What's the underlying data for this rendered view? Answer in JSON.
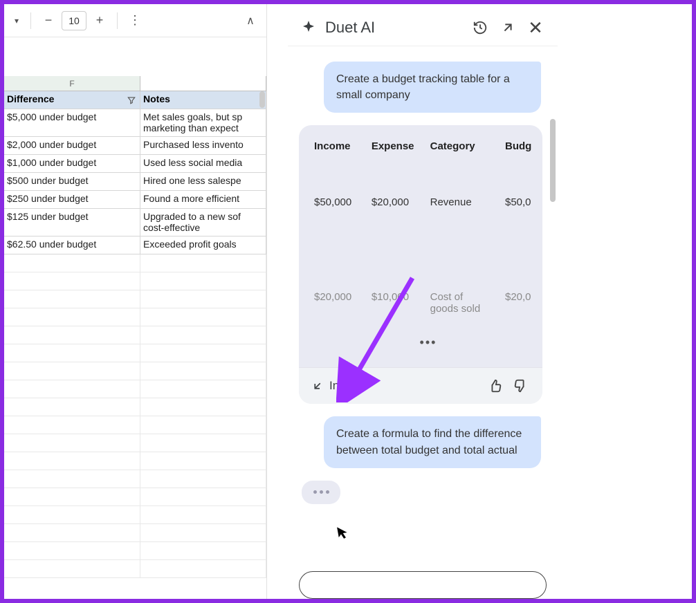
{
  "toolbar": {
    "font_size": "10"
  },
  "columns": {
    "F": "F",
    "difference_header": "Difference",
    "notes_header": "Notes"
  },
  "rows": [
    {
      "diff": "$5,000 under budget",
      "notes": "Met sales goals, but spent more on marketing than expected"
    },
    {
      "diff": "$2,000 under budget",
      "notes": "Purchased less inventory"
    },
    {
      "diff": "$1,000 under budget",
      "notes": "Used less social media"
    },
    {
      "diff": "$500 under budget",
      "notes": "Hired one less salesperson"
    },
    {
      "diff": "$250 under budget",
      "notes": "Found a more efficient"
    },
    {
      "diff": "$125 under budget",
      "notes": "Upgraded to a new software that's cost-effective"
    },
    {
      "diff": "$62.50 under budget",
      "notes": "Exceeded profit goals"
    }
  ],
  "panel": {
    "title": "Duet AI",
    "user_prompt_1": "Create a budget tracking table for a small company",
    "response_table": {
      "columns": [
        "Income",
        "Expense",
        "Category",
        "Budg"
      ],
      "row1": [
        "$50,000",
        "$20,000",
        "Revenue",
        "$50,0"
      ],
      "row2": [
        "$20,000",
        "$10,000",
        "Cost of goods sold",
        "$20,0"
      ]
    },
    "insert_label": "Insert",
    "user_prompt_2": "Create a formula to find the difference between total budget and total actual"
  }
}
